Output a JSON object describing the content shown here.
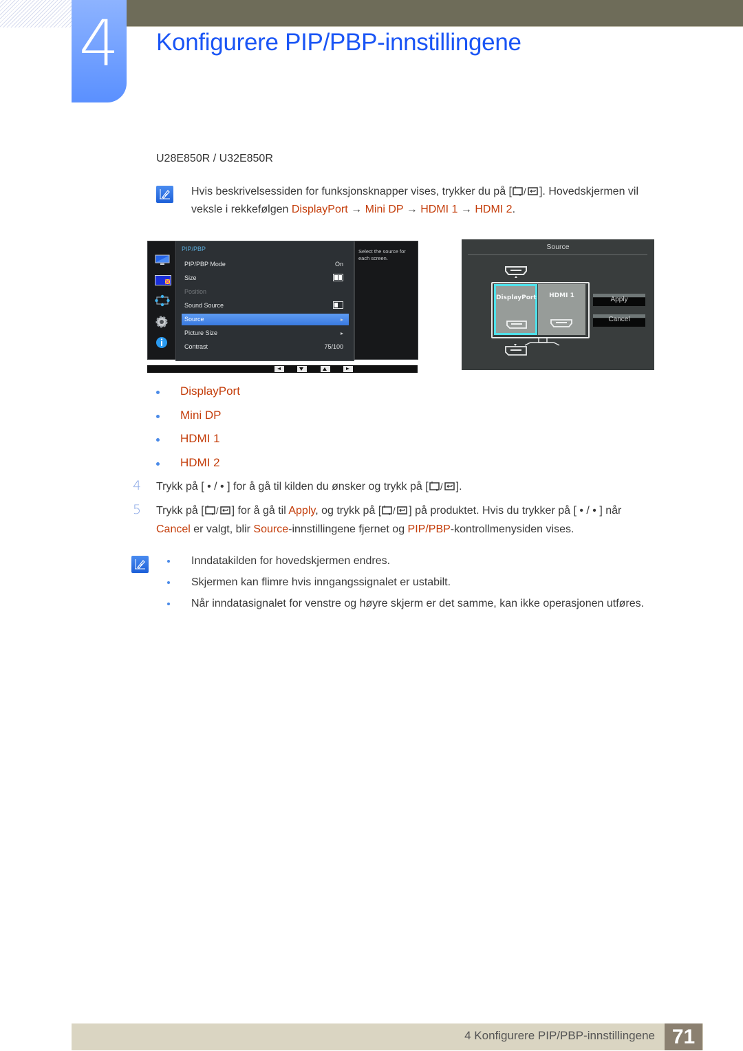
{
  "header": {
    "chapter_number": "4",
    "chapter_title": "Konfigurere PIP/PBP-innstillingene"
  },
  "model_heading": "U28E850R / U32E850R",
  "note1": {
    "text_a": "Hvis beskrivelsessiden for funksjonsknapper vises, trykker du på [",
    "text_b": "]. Hovedskjermen vil",
    "text_c": "veksle i rekkefølgen ",
    "seq": [
      "DisplayPort",
      "Mini DP",
      "HDMI 1",
      "HDMI 2"
    ],
    "arrow": "→",
    "end": "."
  },
  "osd": {
    "title": "PIP/PBP",
    "help_text": "Select the source for each screen.",
    "rows": [
      {
        "label": "PIP/PBP Mode",
        "value": "On"
      },
      {
        "label": "Size",
        "value": ""
      },
      {
        "label": "Position",
        "value": ""
      },
      {
        "label": "Sound Source",
        "value": ""
      },
      {
        "label": "Source",
        "value": ""
      },
      {
        "label": "Picture Size",
        "value": ""
      },
      {
        "label": "Contrast",
        "value": "75/100"
      }
    ],
    "selected_row": "Source",
    "disabled_row": "Position",
    "sidebar_icons": [
      "monitor-icon",
      "pip-icon",
      "resize-icon",
      "settings-gear-icon",
      "info-icon"
    ],
    "nav_buttons": [
      "left-arrow-icon",
      "down-arrow-icon",
      "up-arrow-icon",
      "right-arrow-icon"
    ]
  },
  "source_panel": {
    "title": "Source",
    "left_pane": "DisplayPort",
    "right_pane": "HDMI 1",
    "apply_label": "Apply",
    "cancel_label": "Cancel"
  },
  "source_list": [
    "DisplayPort",
    "Mini DP",
    "HDMI 1",
    "HDMI 2"
  ],
  "steps": [
    {
      "num": "4",
      "a": "Trykk på [ • / • ] for å gå til kilden du ønsker og trykk på [",
      "b": "]."
    },
    {
      "num": "5",
      "a": "Trykk på [",
      "b": "] for å gå til ",
      "apply": "Apply",
      "c": ", og trykk på [",
      "d": "] på produktet. Hvis du trykker på [ • / • ] når",
      "cancel": "Cancel",
      "e": " er valgt, blir ",
      "source": "Source",
      "f": "-innstillingene fjernet og ",
      "pip": "PIP/PBP",
      "g": "-kontrollmenysiden vises."
    }
  ],
  "notes2": [
    "Inndatakilden for hovedskjermen endres.",
    "Skjermen kan flimre hvis inngangssignalet er ustabilt.",
    "Når inndatasignalet for venstre og høyre skjerm er det samme, kan ikke operasjonen utføres."
  ],
  "footer": {
    "text": "4 Konfigurere PIP/PBP-innstillingene",
    "page_number": "71"
  },
  "colors": {
    "title_blue": "#1a55f5",
    "highlight_orange": "#c43d0a",
    "osd_select": "#3a7ae0",
    "source_focus": "#4fe1ea"
  }
}
